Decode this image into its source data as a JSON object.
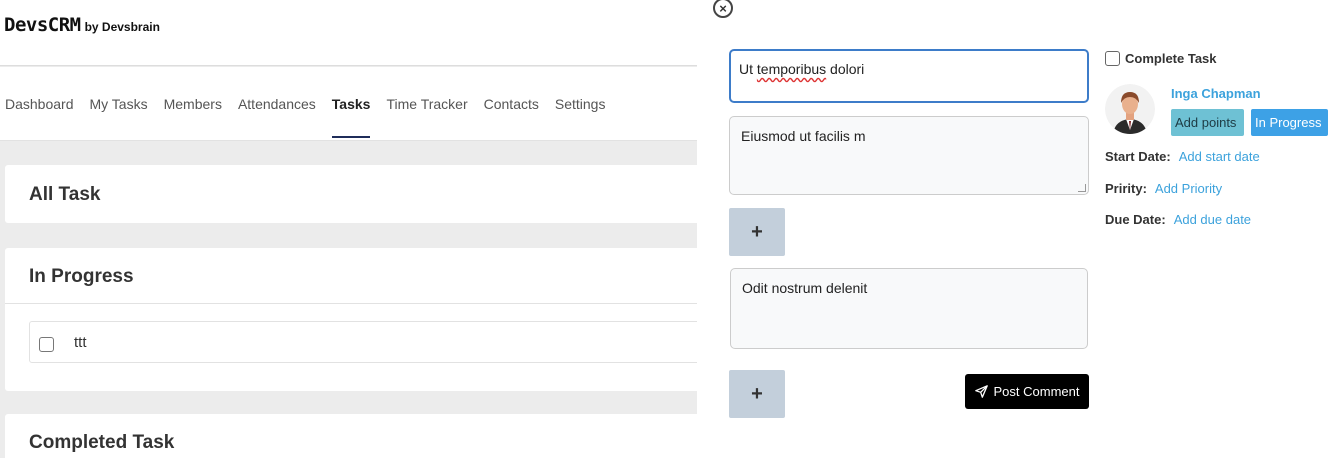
{
  "app": {
    "brand": "DevsCRM",
    "brand_sub": "by Devsbrain"
  },
  "nav": {
    "items": [
      {
        "label": "Dashboard"
      },
      {
        "label": "My Tasks"
      },
      {
        "label": "Members"
      },
      {
        "label": "Attendances"
      },
      {
        "label": "Tasks",
        "active": true
      },
      {
        "label": "Time Tracker"
      },
      {
        "label": "Contacts"
      },
      {
        "label": "Settings"
      }
    ]
  },
  "sections": {
    "all_task": "All Task",
    "in_progress": "In Progress",
    "completed": "Completed Task"
  },
  "tasks": [
    {
      "name": "ttt"
    }
  ],
  "modal": {
    "close_icon": "×",
    "title_prefix": "Ut ",
    "title_misspelled": "temporibus",
    "title_suffix": " dolori",
    "description": "Eiusmod ut facilis m",
    "add_label": "+",
    "comment": "Odit nostrum delenit",
    "post_comment": "Post Comment",
    "complete_task": "Complete Task",
    "assignee": "Inga Chapman",
    "add_points": "Add points",
    "status": "In Progress",
    "start_date_label": "Start Date:",
    "start_date_value": "Add start date",
    "priority_label": "Pririty:",
    "priority_value": "Add Priority",
    "due_date_label": "Due Date:",
    "due_date_value": "Add due date"
  },
  "colors": {
    "accent_link": "#3ca2dc",
    "active_nav_underline": "#1f2d5a",
    "focus_border": "#3d7cc9",
    "badge_points": "#6ec1d4",
    "badge_status": "#3da1e6"
  },
  "icons": {
    "close": "close-icon",
    "send": "send-icon",
    "avatar": "user-avatar"
  }
}
